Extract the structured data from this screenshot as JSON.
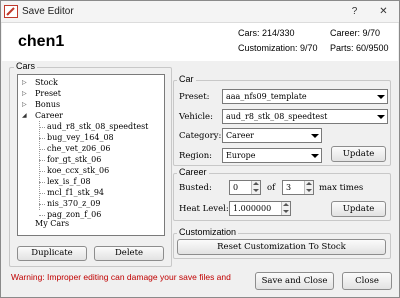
{
  "window": {
    "title": "Save Editor"
  },
  "profile": {
    "name": "chen1",
    "cars": "Cars: 214/330",
    "career": "Career: 9/70",
    "customization": "Customization: 9/70",
    "parts": "Parts: 60/9500"
  },
  "cars_panel": {
    "label": "Cars",
    "tree": {
      "stock": "Stock",
      "preset": "Preset",
      "bonus": "Bonus",
      "career": "Career",
      "career_items": [
        "aud_r8_stk_08_speedtest",
        "bug_vey_164_08",
        "che_vet_z06_06",
        "for_gt_stk_06",
        "koe_ccx_stk_06",
        "lex_is_f_08",
        "mcl_f1_stk_94",
        "nis_370_z_09",
        "pag_zon_f_06"
      ],
      "my_cars": "My Cars"
    },
    "duplicate_label": "Duplicate",
    "delete_label": "Delete"
  },
  "car_group": {
    "label": "Car",
    "preset_label": "Preset:",
    "preset_value": "aaa_nfs09_template",
    "vehicle_label": "Vehicle:",
    "vehicle_value": "aud_r8_stk_08_speedtest",
    "category_label": "Category:",
    "category_value": "Career",
    "region_label": "Region:",
    "region_value": "Europe",
    "update_label": "Update"
  },
  "career_group": {
    "label": "Career",
    "busted_label": "Busted:",
    "busted_value": "0",
    "of_label": "of",
    "max_value": "3",
    "max_times_label": "max times",
    "heat_label": "Heat Level:",
    "heat_value": "1.000000",
    "update_label": "Update"
  },
  "customization_group": {
    "label": "Customization",
    "reset_label": "Reset Customization To Stock"
  },
  "footer": {
    "warning": "Warning: Improper editing can damage your save files and",
    "save_close_label": "Save and Close",
    "close_label": "Close"
  },
  "colors": {
    "warning": "#c00000",
    "title_icon": "#c0392b"
  }
}
